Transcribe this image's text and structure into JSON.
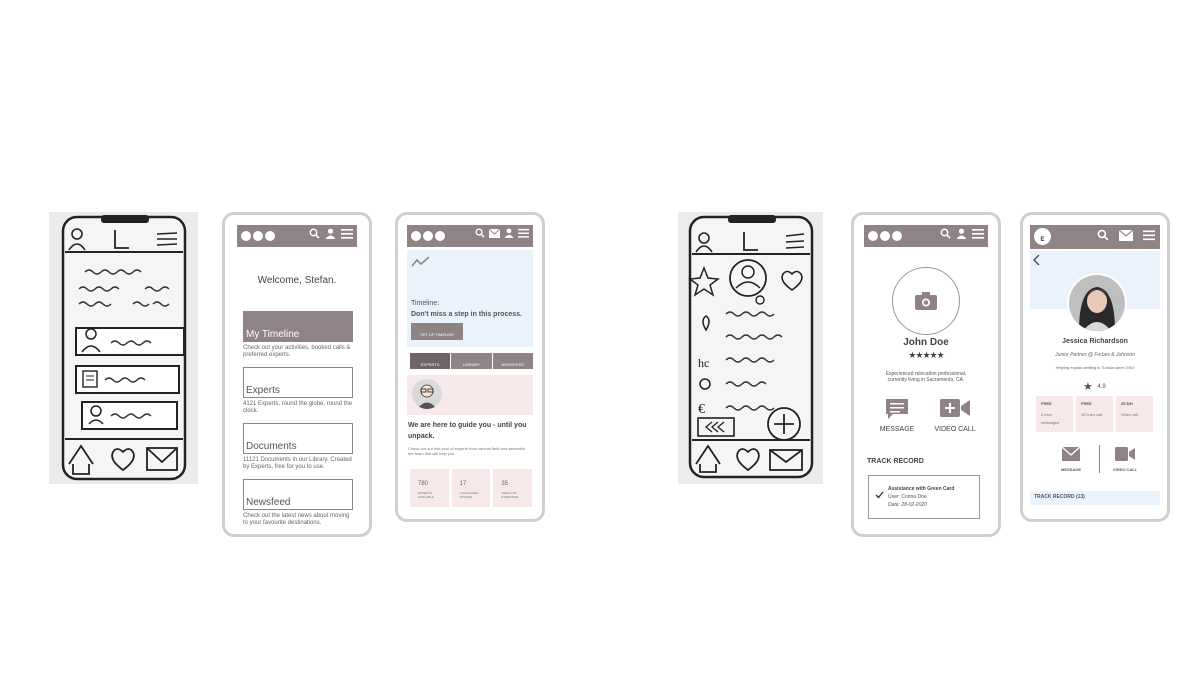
{
  "colors": {
    "nav": "#8f8385",
    "pink": "#f7e9ea",
    "blue": "#eaf3fb",
    "frame": "#cfcfcf"
  },
  "screen1": {
    "welcome": "Welcome, Stefan.",
    "timeline_label": "My Timeline",
    "timeline_desc": "Check out your activities, booked calls & preferred experts.",
    "experts_label": "Experts",
    "experts_desc": "4121 Experts, round the globe, round the clock.",
    "documents_label": "Documents",
    "documents_desc": "11121 Documents in our Library. Created by Experts, free for you to use.",
    "newsfeed_label": "Newsfeed",
    "newsfeed_desc": "Check out the latest news about moving to your favourite destinations."
  },
  "screen2": {
    "timeline_title": "Timeline:",
    "timeline_sub": "Don't miss a step in this process.",
    "setup_btn": "SET UP TIMELINE",
    "tabs": [
      "EXPERTS",
      "LIBRARY",
      "NEWSFEED"
    ],
    "guide_title": "We are here to guide you - until you unpack.",
    "guide_desc": "Check out our hint pool of experts from various field and assemble the team that will help you.",
    "stats": [
      {
        "value": "780",
        "label": "EXPERTS AVAILABLE"
      },
      {
        "value": "17",
        "label": "LANGUAGES SPOKEN"
      },
      {
        "value": "35",
        "label": "AREAS OF EXPERTISE"
      }
    ]
  },
  "screen3": {
    "name": "John Doe",
    "stars": "★★★★★",
    "bio": "Experienced relocation professional, currently living in Sacramento, CA.",
    "message_label": "MESSAGE",
    "video_label": "VIDEO CALL",
    "track_title": "TRACK RECORD",
    "record_title": "Assistance with Green Card",
    "record_user": "User: Corina Doe",
    "record_date": "Date: 28-02-2020"
  },
  "screen4": {
    "avatar_letter": "E",
    "name": "Jessica Richardson",
    "role": "Junior Partner @ Forbes & Johnson",
    "tagline": "Helping expats settling in Tunisia since 2003",
    "rating": "4.9",
    "offers": [
      {
        "price": "FREE",
        "desc": "2 intro messages"
      },
      {
        "price": "FREE",
        "desc": "15' intro call"
      },
      {
        "price": "25 $/H",
        "desc": "Video call"
      }
    ],
    "message_label": "MESSAGE",
    "video_label": "VIDEO CALL",
    "track_title": "TRACK RECORD (13)"
  }
}
